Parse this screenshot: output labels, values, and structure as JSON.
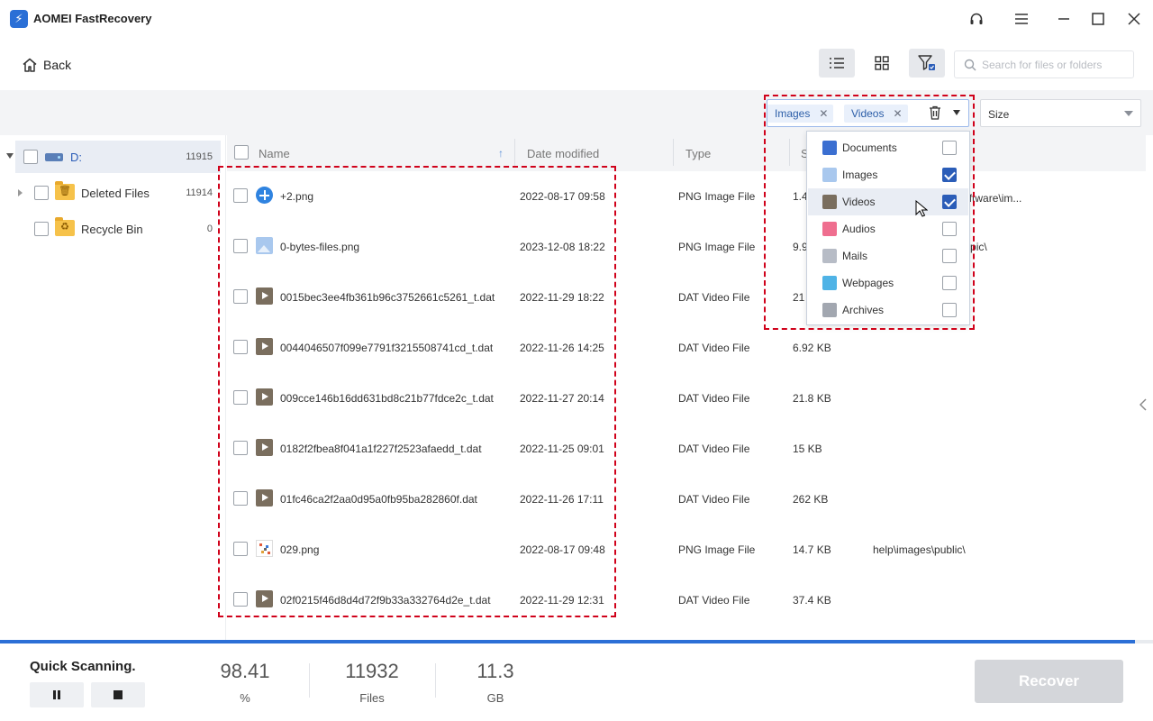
{
  "app": {
    "title": "AOMEI FastRecovery"
  },
  "toolbar": {
    "back_label": "Back",
    "search_placeholder": "Search for files or folders"
  },
  "filter": {
    "chips": [
      {
        "label": "Images"
      },
      {
        "label": "Videos"
      }
    ],
    "size_label": "Size"
  },
  "tree": {
    "items": [
      {
        "label": "D:",
        "count": "11915"
      },
      {
        "label": "Deleted Files",
        "count": "11914"
      },
      {
        "label": "Recycle Bin",
        "count": "0"
      }
    ]
  },
  "list": {
    "columns": {
      "name": "Name",
      "date": "Date modified",
      "type": "Type",
      "size": "S"
    },
    "rows": [
      {
        "name": "+2.png",
        "date": "2022-08-17 09:58",
        "type": "PNG Image File",
        "size": "1.4",
        "path": "页面备份\\backup-software\\im...",
        "icon": "plus-icon"
      },
      {
        "name": "0-bytes-files.png",
        "date": "2023-12-08 18:22",
        "type": "PNG Image File",
        "size": "9.9",
        "path": "ecovery-disk\\theme-pic\\",
        "icon": "image-icon"
      },
      {
        "name": "0015bec3ee4fb361b96c3752661c5261_t.dat",
        "date": "2022-11-29 18:22",
        "type": "DAT Video File",
        "size": "21",
        "path": "",
        "icon": "video-icon"
      },
      {
        "name": "0044046507f099e7791f3215508741cd_t.dat",
        "date": "2022-11-26 14:25",
        "type": "DAT Video File",
        "size": "6.92 KB",
        "path": "",
        "icon": "video-icon"
      },
      {
        "name": "009cce146b16dd631bd8c21b77fdce2c_t.dat",
        "date": "2022-11-27 20:14",
        "type": "DAT Video File",
        "size": "21.8 KB",
        "path": "",
        "icon": "video-icon"
      },
      {
        "name": "0182f2fbea8f041a1f227f2523afaedd_t.dat",
        "date": "2022-11-25 09:01",
        "type": "DAT Video File",
        "size": "15 KB",
        "path": "",
        "icon": "video-icon"
      },
      {
        "name": "01fc46ca2f2aa0d95a0fb95ba282860f.dat",
        "date": "2022-11-26 17:11",
        "type": "DAT Video File",
        "size": "262 KB",
        "path": "",
        "icon": "video-icon"
      },
      {
        "name": "029.png",
        "date": "2022-08-17 09:48",
        "type": "PNG Image File",
        "size": "14.7 KB",
        "path": "help\\images\\public\\",
        "icon": "thumbnail-icon"
      },
      {
        "name": "02f0215f46d8d4d72f9b33a332764d2e_t.dat",
        "date": "2022-11-29 12:31",
        "type": "DAT Video File",
        "size": "37.4 KB",
        "path": "",
        "icon": "video-icon"
      }
    ]
  },
  "type_dropdown": {
    "items": [
      {
        "label": "Documents",
        "checked": false,
        "icon": "document-icon",
        "color": "#3b6fd1"
      },
      {
        "label": "Images",
        "checked": true,
        "icon": "image-icon",
        "color": "#a9c8ee"
      },
      {
        "label": "Videos",
        "checked": true,
        "icon": "video-icon",
        "color": "#7a6e5e"
      },
      {
        "label": "Audios",
        "checked": false,
        "icon": "audio-icon",
        "color": "#ef6e8f"
      },
      {
        "label": "Mails",
        "checked": false,
        "icon": "mail-icon",
        "color": "#b7bcc6"
      },
      {
        "label": "Webpages",
        "checked": false,
        "icon": "webpage-icon",
        "color": "#4fb3e6"
      },
      {
        "label": "Archives",
        "checked": false,
        "icon": "archive-icon",
        "color": "#a2a7b0"
      }
    ]
  },
  "status": {
    "title": "Quick Scanning.",
    "progress": 0.9841,
    "percent": "98.41",
    "percent_unit": "%",
    "files": "11932",
    "files_unit": "Files",
    "gb": "11.3",
    "gb_unit": "GB",
    "recover_label": "Recover"
  },
  "colors": {
    "accent": "#2c6fd6",
    "highlight": "#d0021b",
    "checkbox": "#2b5db8"
  }
}
